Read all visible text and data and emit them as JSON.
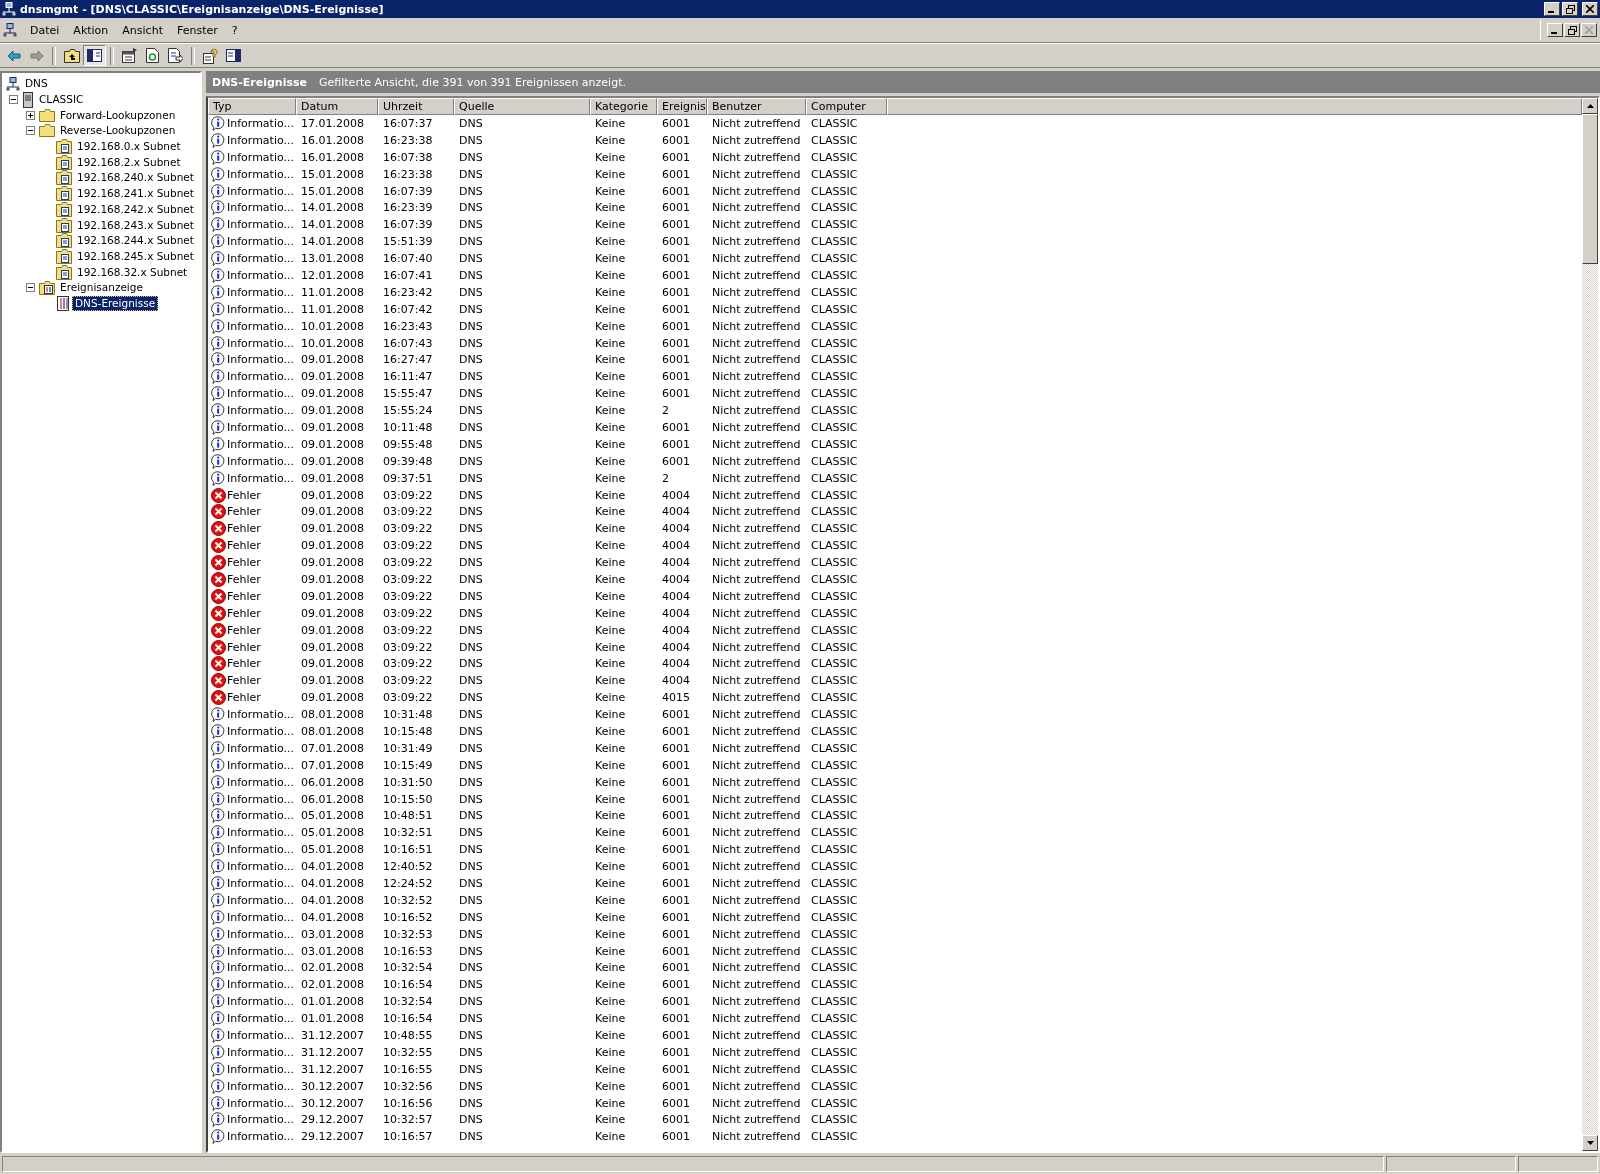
{
  "window": {
    "title": "dnsmgmt - [DNS\\CLASSIC\\Ereignisanzeige\\DNS-Ereignisse]"
  },
  "menu": [
    "Datei",
    "Aktion",
    "Ansicht",
    "Fenster",
    "?"
  ],
  "toolbar": [
    {
      "kind": "back",
      "pressed": false
    },
    {
      "kind": "forward",
      "pressed": false
    },
    {
      "kind": "separator"
    },
    {
      "kind": "up",
      "pressed": false
    },
    {
      "kind": "tree-toggle",
      "pressed": true
    },
    {
      "kind": "separator"
    },
    {
      "kind": "properties",
      "pressed": false
    },
    {
      "kind": "refresh",
      "pressed": false
    },
    {
      "kind": "export",
      "pressed": false
    },
    {
      "kind": "separator"
    },
    {
      "kind": "help",
      "pressed": false
    },
    {
      "kind": "action-pane",
      "pressed": false
    }
  ],
  "tree": [
    {
      "label": "DNS",
      "kind": "dns",
      "selected": false,
      "children": [
        {
          "label": "CLASSIC",
          "kind": "server",
          "selected": false,
          "expanded": true,
          "children": [
            {
              "label": "Forward-Lookupzonen",
              "kind": "folder",
              "selected": false,
              "expanded": false
            },
            {
              "label": "Reverse-Lookupzonen",
              "kind": "folder",
              "selected": false,
              "expanded": true,
              "children": [
                {
                  "label": "192.168.0.x Subnet",
                  "kind": "zone",
                  "selected": false
                },
                {
                  "label": "192.168.2.x Subnet",
                  "kind": "zone",
                  "selected": false
                },
                {
                  "label": "192.168.240.x Subnet",
                  "kind": "zone",
                  "selected": false
                },
                {
                  "label": "192.168.241.x Subnet",
                  "kind": "zone",
                  "selected": false
                },
                {
                  "label": "192.168.242.x Subnet",
                  "kind": "zone",
                  "selected": false
                },
                {
                  "label": "192.168.243.x Subnet",
                  "kind": "zone",
                  "selected": false
                },
                {
                  "label": "192.168.244.x Subnet",
                  "kind": "zone",
                  "selected": false
                },
                {
                  "label": "192.168.245.x Subnet",
                  "kind": "zone",
                  "selected": false
                },
                {
                  "label": "192.168.32.x Subnet",
                  "kind": "zone",
                  "selected": false
                }
              ]
            },
            {
              "label": "Ereignisanzeige",
              "kind": "eventviewer",
              "selected": false,
              "expanded": true,
              "children": [
                {
                  "label": "DNS-Ereignisse",
                  "kind": "log",
                  "selected": true
                }
              ]
            }
          ]
        }
      ]
    }
  ],
  "pane": {
    "title": "DNS-Ereignisse",
    "description": "Gefilterte Ansicht, die 391 von 391 Ereignissen anzeigt."
  },
  "table": {
    "columns": [
      "Typ",
      "Datum",
      "Uhrzeit",
      "Quelle",
      "Kategorie",
      "Ereignis",
      "Benutzer",
      "Computer"
    ],
    "rows": [
      {
        "kind": "info",
        "cells": [
          "Informatio...",
          "17.01.2008",
          "16:07:37",
          "DNS",
          "Keine",
          "6001",
          "Nicht zutreffend",
          "CLASSIC"
        ]
      },
      {
        "kind": "info",
        "cells": [
          "Informatio...",
          "16.01.2008",
          "16:23:38",
          "DNS",
          "Keine",
          "6001",
          "Nicht zutreffend",
          "CLASSIC"
        ]
      },
      {
        "kind": "info",
        "cells": [
          "Informatio...",
          "16.01.2008",
          "16:07:38",
          "DNS",
          "Keine",
          "6001",
          "Nicht zutreffend",
          "CLASSIC"
        ]
      },
      {
        "kind": "info",
        "cells": [
          "Informatio...",
          "15.01.2008",
          "16:23:38",
          "DNS",
          "Keine",
          "6001",
          "Nicht zutreffend",
          "CLASSIC"
        ]
      },
      {
        "kind": "info",
        "cells": [
          "Informatio...",
          "15.01.2008",
          "16:07:39",
          "DNS",
          "Keine",
          "6001",
          "Nicht zutreffend",
          "CLASSIC"
        ]
      },
      {
        "kind": "info",
        "cells": [
          "Informatio...",
          "14.01.2008",
          "16:23:39",
          "DNS",
          "Keine",
          "6001",
          "Nicht zutreffend",
          "CLASSIC"
        ]
      },
      {
        "kind": "info",
        "cells": [
          "Informatio...",
          "14.01.2008",
          "16:07:39",
          "DNS",
          "Keine",
          "6001",
          "Nicht zutreffend",
          "CLASSIC"
        ]
      },
      {
        "kind": "info",
        "cells": [
          "Informatio...",
          "14.01.2008",
          "15:51:39",
          "DNS",
          "Keine",
          "6001",
          "Nicht zutreffend",
          "CLASSIC"
        ]
      },
      {
        "kind": "info",
        "cells": [
          "Informatio...",
          "13.01.2008",
          "16:07:40",
          "DNS",
          "Keine",
          "6001",
          "Nicht zutreffend",
          "CLASSIC"
        ]
      },
      {
        "kind": "info",
        "cells": [
          "Informatio...",
          "12.01.2008",
          "16:07:41",
          "DNS",
          "Keine",
          "6001",
          "Nicht zutreffend",
          "CLASSIC"
        ]
      },
      {
        "kind": "info",
        "cells": [
          "Informatio...",
          "11.01.2008",
          "16:23:42",
          "DNS",
          "Keine",
          "6001",
          "Nicht zutreffend",
          "CLASSIC"
        ]
      },
      {
        "kind": "info",
        "cells": [
          "Informatio...",
          "11.01.2008",
          "16:07:42",
          "DNS",
          "Keine",
          "6001",
          "Nicht zutreffend",
          "CLASSIC"
        ]
      },
      {
        "kind": "info",
        "cells": [
          "Informatio...",
          "10.01.2008",
          "16:23:43",
          "DNS",
          "Keine",
          "6001",
          "Nicht zutreffend",
          "CLASSIC"
        ]
      },
      {
        "kind": "info",
        "cells": [
          "Informatio...",
          "10.01.2008",
          "16:07:43",
          "DNS",
          "Keine",
          "6001",
          "Nicht zutreffend",
          "CLASSIC"
        ]
      },
      {
        "kind": "info",
        "cells": [
          "Informatio...",
          "09.01.2008",
          "16:27:47",
          "DNS",
          "Keine",
          "6001",
          "Nicht zutreffend",
          "CLASSIC"
        ]
      },
      {
        "kind": "info",
        "cells": [
          "Informatio...",
          "09.01.2008",
          "16:11:47",
          "DNS",
          "Keine",
          "6001",
          "Nicht zutreffend",
          "CLASSIC"
        ]
      },
      {
        "kind": "info",
        "cells": [
          "Informatio...",
          "09.01.2008",
          "15:55:47",
          "DNS",
          "Keine",
          "6001",
          "Nicht zutreffend",
          "CLASSIC"
        ]
      },
      {
        "kind": "info",
        "cells": [
          "Informatio...",
          "09.01.2008",
          "15:55:24",
          "DNS",
          "Keine",
          "2",
          "Nicht zutreffend",
          "CLASSIC"
        ]
      },
      {
        "kind": "info",
        "cells": [
          "Informatio...",
          "09.01.2008",
          "10:11:48",
          "DNS",
          "Keine",
          "6001",
          "Nicht zutreffend",
          "CLASSIC"
        ]
      },
      {
        "kind": "info",
        "cells": [
          "Informatio...",
          "09.01.2008",
          "09:55:48",
          "DNS",
          "Keine",
          "6001",
          "Nicht zutreffend",
          "CLASSIC"
        ]
      },
      {
        "kind": "info",
        "cells": [
          "Informatio...",
          "09.01.2008",
          "09:39:48",
          "DNS",
          "Keine",
          "6001",
          "Nicht zutreffend",
          "CLASSIC"
        ]
      },
      {
        "kind": "info",
        "cells": [
          "Informatio...",
          "09.01.2008",
          "09:37:51",
          "DNS",
          "Keine",
          "2",
          "Nicht zutreffend",
          "CLASSIC"
        ]
      },
      {
        "kind": "error",
        "cells": [
          "Fehler",
          "09.01.2008",
          "03:09:22",
          "DNS",
          "Keine",
          "4004",
          "Nicht zutreffend",
          "CLASSIC"
        ]
      },
      {
        "kind": "error",
        "cells": [
          "Fehler",
          "09.01.2008",
          "03:09:22",
          "DNS",
          "Keine",
          "4004",
          "Nicht zutreffend",
          "CLASSIC"
        ]
      },
      {
        "kind": "error",
        "cells": [
          "Fehler",
          "09.01.2008",
          "03:09:22",
          "DNS",
          "Keine",
          "4004",
          "Nicht zutreffend",
          "CLASSIC"
        ]
      },
      {
        "kind": "error",
        "cells": [
          "Fehler",
          "09.01.2008",
          "03:09:22",
          "DNS",
          "Keine",
          "4004",
          "Nicht zutreffend",
          "CLASSIC"
        ]
      },
      {
        "kind": "error",
        "cells": [
          "Fehler",
          "09.01.2008",
          "03:09:22",
          "DNS",
          "Keine",
          "4004",
          "Nicht zutreffend",
          "CLASSIC"
        ]
      },
      {
        "kind": "error",
        "cells": [
          "Fehler",
          "09.01.2008",
          "03:09:22",
          "DNS",
          "Keine",
          "4004",
          "Nicht zutreffend",
          "CLASSIC"
        ]
      },
      {
        "kind": "error",
        "cells": [
          "Fehler",
          "09.01.2008",
          "03:09:22",
          "DNS",
          "Keine",
          "4004",
          "Nicht zutreffend",
          "CLASSIC"
        ]
      },
      {
        "kind": "error",
        "cells": [
          "Fehler",
          "09.01.2008",
          "03:09:22",
          "DNS",
          "Keine",
          "4004",
          "Nicht zutreffend",
          "CLASSIC"
        ]
      },
      {
        "kind": "error",
        "cells": [
          "Fehler",
          "09.01.2008",
          "03:09:22",
          "DNS",
          "Keine",
          "4004",
          "Nicht zutreffend",
          "CLASSIC"
        ]
      },
      {
        "kind": "error",
        "cells": [
          "Fehler",
          "09.01.2008",
          "03:09:22",
          "DNS",
          "Keine",
          "4004",
          "Nicht zutreffend",
          "CLASSIC"
        ]
      },
      {
        "kind": "error",
        "cells": [
          "Fehler",
          "09.01.2008",
          "03:09:22",
          "DNS",
          "Keine",
          "4004",
          "Nicht zutreffend",
          "CLASSIC"
        ]
      },
      {
        "kind": "error",
        "cells": [
          "Fehler",
          "09.01.2008",
          "03:09:22",
          "DNS",
          "Keine",
          "4004",
          "Nicht zutreffend",
          "CLASSIC"
        ]
      },
      {
        "kind": "error",
        "cells": [
          "Fehler",
          "09.01.2008",
          "03:09:22",
          "DNS",
          "Keine",
          "4015",
          "Nicht zutreffend",
          "CLASSIC"
        ]
      },
      {
        "kind": "info",
        "cells": [
          "Informatio...",
          "08.01.2008",
          "10:31:48",
          "DNS",
          "Keine",
          "6001",
          "Nicht zutreffend",
          "CLASSIC"
        ]
      },
      {
        "kind": "info",
        "cells": [
          "Informatio...",
          "08.01.2008",
          "10:15:48",
          "DNS",
          "Keine",
          "6001",
          "Nicht zutreffend",
          "CLASSIC"
        ]
      },
      {
        "kind": "info",
        "cells": [
          "Informatio...",
          "07.01.2008",
          "10:31:49",
          "DNS",
          "Keine",
          "6001",
          "Nicht zutreffend",
          "CLASSIC"
        ]
      },
      {
        "kind": "info",
        "cells": [
          "Informatio...",
          "07.01.2008",
          "10:15:49",
          "DNS",
          "Keine",
          "6001",
          "Nicht zutreffend",
          "CLASSIC"
        ]
      },
      {
        "kind": "info",
        "cells": [
          "Informatio...",
          "06.01.2008",
          "10:31:50",
          "DNS",
          "Keine",
          "6001",
          "Nicht zutreffend",
          "CLASSIC"
        ]
      },
      {
        "kind": "info",
        "cells": [
          "Informatio...",
          "06.01.2008",
          "10:15:50",
          "DNS",
          "Keine",
          "6001",
          "Nicht zutreffend",
          "CLASSIC"
        ]
      },
      {
        "kind": "info",
        "cells": [
          "Informatio...",
          "05.01.2008",
          "10:48:51",
          "DNS",
          "Keine",
          "6001",
          "Nicht zutreffend",
          "CLASSIC"
        ]
      },
      {
        "kind": "info",
        "cells": [
          "Informatio...",
          "05.01.2008",
          "10:32:51",
          "DNS",
          "Keine",
          "6001",
          "Nicht zutreffend",
          "CLASSIC"
        ]
      },
      {
        "kind": "info",
        "cells": [
          "Informatio...",
          "05.01.2008",
          "10:16:51",
          "DNS",
          "Keine",
          "6001",
          "Nicht zutreffend",
          "CLASSIC"
        ]
      },
      {
        "kind": "info",
        "cells": [
          "Informatio...",
          "04.01.2008",
          "12:40:52",
          "DNS",
          "Keine",
          "6001",
          "Nicht zutreffend",
          "CLASSIC"
        ]
      },
      {
        "kind": "info",
        "cells": [
          "Informatio...",
          "04.01.2008",
          "12:24:52",
          "DNS",
          "Keine",
          "6001",
          "Nicht zutreffend",
          "CLASSIC"
        ]
      },
      {
        "kind": "info",
        "cells": [
          "Informatio...",
          "04.01.2008",
          "10:32:52",
          "DNS",
          "Keine",
          "6001",
          "Nicht zutreffend",
          "CLASSIC"
        ]
      },
      {
        "kind": "info",
        "cells": [
          "Informatio...",
          "04.01.2008",
          "10:16:52",
          "DNS",
          "Keine",
          "6001",
          "Nicht zutreffend",
          "CLASSIC"
        ]
      },
      {
        "kind": "info",
        "cells": [
          "Informatio...",
          "03.01.2008",
          "10:32:53",
          "DNS",
          "Keine",
          "6001",
          "Nicht zutreffend",
          "CLASSIC"
        ]
      },
      {
        "kind": "info",
        "cells": [
          "Informatio...",
          "03.01.2008",
          "10:16:53",
          "DNS",
          "Keine",
          "6001",
          "Nicht zutreffend",
          "CLASSIC"
        ]
      },
      {
        "kind": "info",
        "cells": [
          "Informatio...",
          "02.01.2008",
          "10:32:54",
          "DNS",
          "Keine",
          "6001",
          "Nicht zutreffend",
          "CLASSIC"
        ]
      },
      {
        "kind": "info",
        "cells": [
          "Informatio...",
          "02.01.2008",
          "10:16:54",
          "DNS",
          "Keine",
          "6001",
          "Nicht zutreffend",
          "CLASSIC"
        ]
      },
      {
        "kind": "info",
        "cells": [
          "Informatio...",
          "01.01.2008",
          "10:32:54",
          "DNS",
          "Keine",
          "6001",
          "Nicht zutreffend",
          "CLASSIC"
        ]
      },
      {
        "kind": "info",
        "cells": [
          "Informatio...",
          "01.01.2008",
          "10:16:54",
          "DNS",
          "Keine",
          "6001",
          "Nicht zutreffend",
          "CLASSIC"
        ]
      },
      {
        "kind": "info",
        "cells": [
          "Informatio...",
          "31.12.2007",
          "10:48:55",
          "DNS",
          "Keine",
          "6001",
          "Nicht zutreffend",
          "CLASSIC"
        ]
      },
      {
        "kind": "info",
        "cells": [
          "Informatio...",
          "31.12.2007",
          "10:32:55",
          "DNS",
          "Keine",
          "6001",
          "Nicht zutreffend",
          "CLASSIC"
        ]
      },
      {
        "kind": "info",
        "cells": [
          "Informatio...",
          "31.12.2007",
          "10:16:55",
          "DNS",
          "Keine",
          "6001",
          "Nicht zutreffend",
          "CLASSIC"
        ]
      },
      {
        "kind": "info",
        "cells": [
          "Informatio...",
          "30.12.2007",
          "10:32:56",
          "DNS",
          "Keine",
          "6001",
          "Nicht zutreffend",
          "CLASSIC"
        ]
      },
      {
        "kind": "info",
        "cells": [
          "Informatio...",
          "30.12.2007",
          "10:16:56",
          "DNS",
          "Keine",
          "6001",
          "Nicht zutreffend",
          "CLASSIC"
        ]
      },
      {
        "kind": "info",
        "cells": [
          "Informatio...",
          "29.12.2007",
          "10:32:57",
          "DNS",
          "Keine",
          "6001",
          "Nicht zutreffend",
          "CLASSIC"
        ]
      },
      {
        "kind": "info",
        "cells": [
          "Informatio...",
          "29.12.2007",
          "10:16:57",
          "DNS",
          "Keine",
          "6001",
          "Nicht zutreffend",
          "CLASSIC"
        ]
      }
    ]
  }
}
